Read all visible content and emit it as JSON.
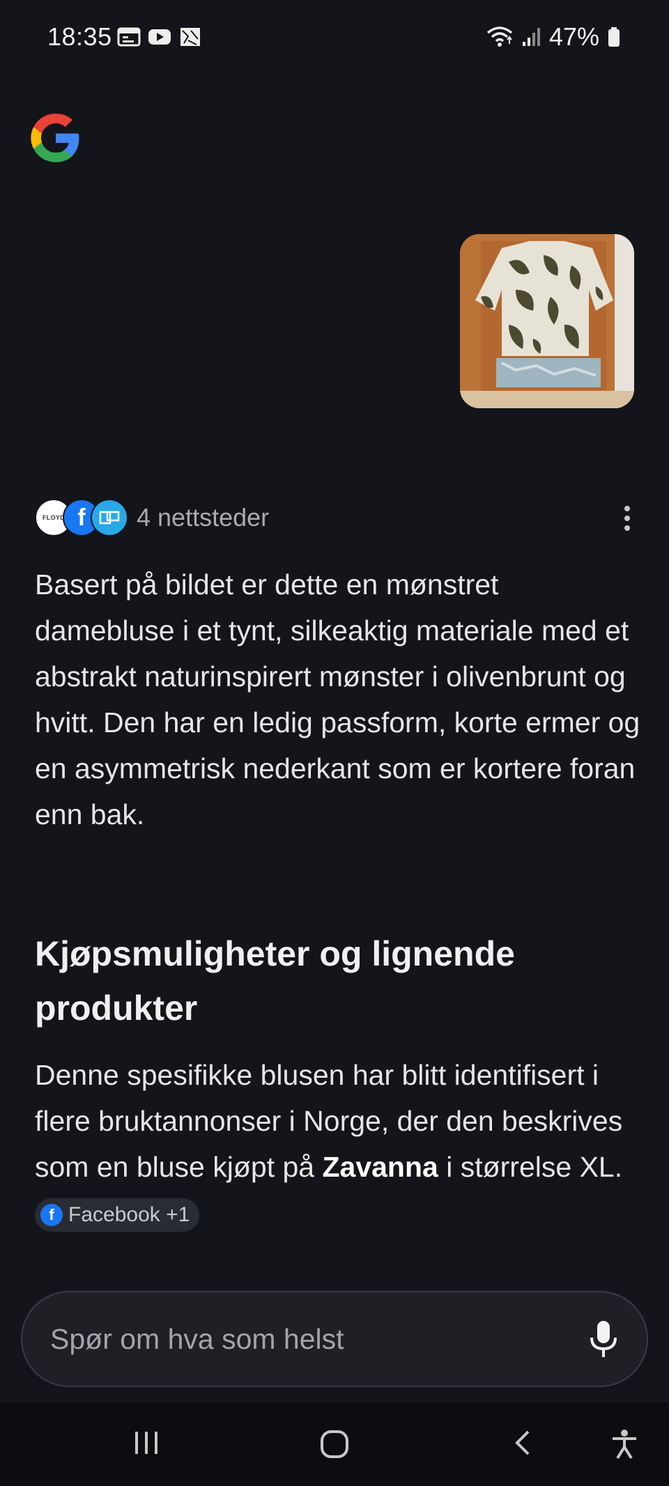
{
  "status_bar": {
    "time": "18:35",
    "battery": "47%",
    "notification_icons": [
      "calendar-icon",
      "youtube-icon",
      "gallery-icon"
    ]
  },
  "sources": {
    "label": "4 nettsteder",
    "icons": [
      "floyd-logo",
      "facebook-icon",
      "blue-site-icon"
    ],
    "floyd_text": "FLOYD"
  },
  "answer": {
    "paragraph": "Basert på bildet er dette en mønstret damebluse i et tynt, silkeaktig materiale med et abstrakt naturinspirert mønster i olivenbrunt og hvitt. Den har en ledig passform, korte ermer og en asymmetrisk nederkant som er kortere foran enn bak."
  },
  "section": {
    "heading": "Kjøpsmuligheter og lignende produkter",
    "text_before": "Denne spesifikke blusen har blitt identifisert i flere bruktannonser i Norge, der den beskrives som en bluse kjøpt på ",
    "brand": "Zavanna",
    "text_after": " i størrelse XL. ",
    "chip_label": "Facebook +1"
  },
  "search": {
    "placeholder": "Spør om hva som helst"
  },
  "colors": {
    "background": "#14151a",
    "facebook": "#1877f2",
    "chip_bg": "#2a2c33"
  }
}
